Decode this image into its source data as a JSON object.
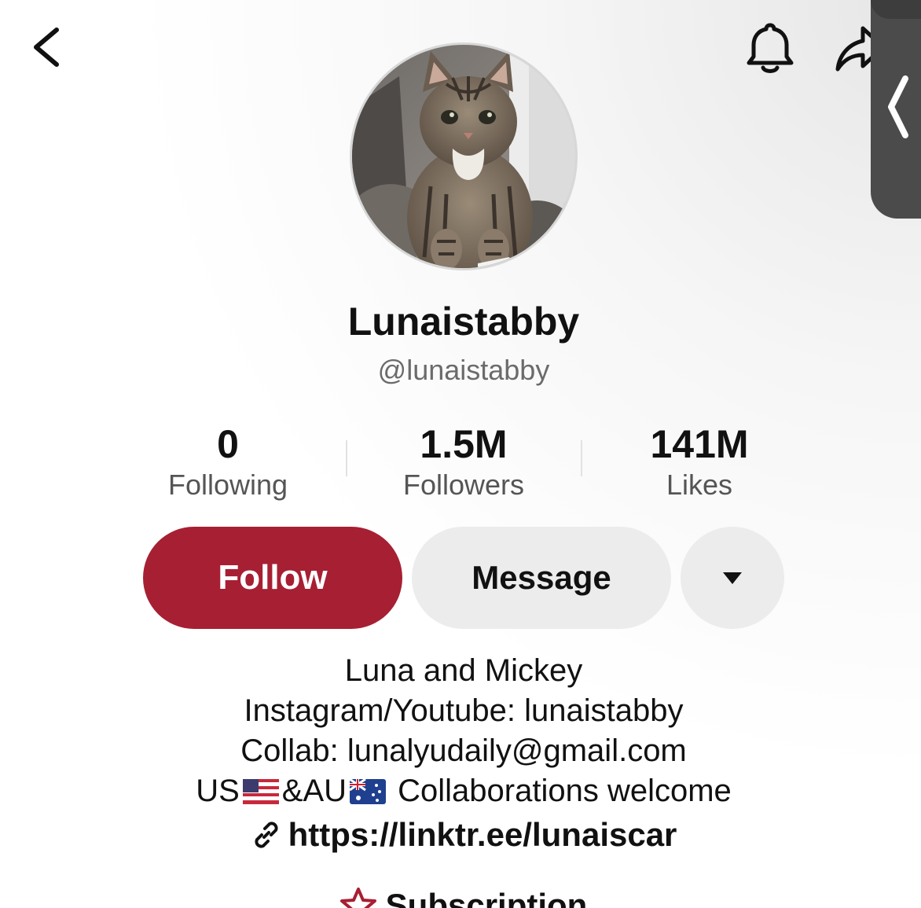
{
  "header": {
    "back_icon": "chevron-left-icon",
    "bell_icon": "bell-icon",
    "share_icon": "share-icon"
  },
  "profile": {
    "display_name": "Lunaistabby",
    "username": "@lunaistabby",
    "avatar": "tabby-cat-avatar"
  },
  "stats": [
    {
      "value": "0",
      "label": "Following"
    },
    {
      "value": "1.5M",
      "label": "Followers"
    },
    {
      "value": "141M",
      "label": "Likes"
    }
  ],
  "actions": {
    "follow_label": "Follow",
    "message_label": "Message",
    "more_icon": "caret-down-icon"
  },
  "bio": {
    "line1": "Luna and Mickey",
    "line2": "Instagram/Youtube: lunaistabby",
    "line3": "Collab:  lunalyudaily@gmail.com",
    "line4_part1": "US",
    "line4_part2": "&AU",
    "line4_part3": " Collaborations welcome"
  },
  "link": {
    "url": "https://linktr.ee/lunaiscar",
    "icon": "link-icon"
  },
  "subscription": {
    "label": "Subscription",
    "icon": "star-icon"
  },
  "colors": {
    "follow_button": "#a71f33",
    "secondary_button": "#ececec",
    "muted_text": "#6b6b6b"
  }
}
